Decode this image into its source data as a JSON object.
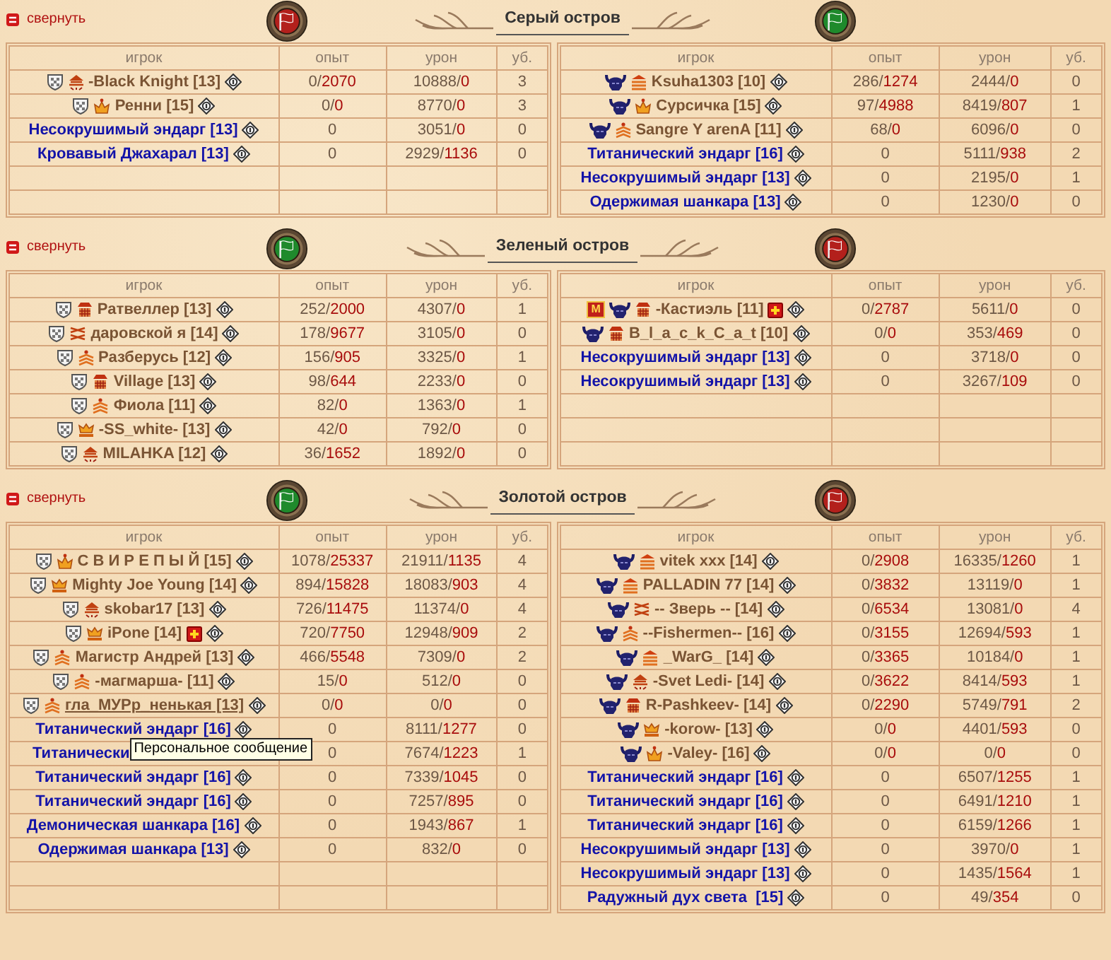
{
  "sections": [
    {
      "collapse_label": "свернуть",
      "title": "Серый остров",
      "flags": [
        {
          "color": "#b3201c"
        },
        {
          "color": "#1f8a2c"
        }
      ],
      "teams": [
        {
          "columns": [
            "игрок",
            "опыт",
            "урон",
            "уб."
          ],
          "rows": [
            {
              "kind": "player",
              "icons": [
                {
                  "kind": "shield"
                },
                {
                  "kind": "pyramid"
                }
              ],
              "name": "-Black Knight [13]",
              "after": [
                {
                  "kind": "info"
                }
              ],
              "hovered": false,
              "exp": "0/2070",
              "damage": "10888/0",
              "kills": "3"
            },
            {
              "kind": "player",
              "icons": [
                {
                  "kind": "shield"
                },
                {
                  "kind": "crown"
                }
              ],
              "name": "Ренни [15]",
              "after": [
                {
                  "kind": "info"
                }
              ],
              "hovered": false,
              "exp": "0/0",
              "damage": "8770/0",
              "kills": "3"
            },
            {
              "kind": "monster",
              "name": "Несокрушимый эндарг [13]",
              "after": [
                {
                  "kind": "info"
                }
              ],
              "hovered": false,
              "exp": "0",
              "damage": "3051/0",
              "kills": "0"
            },
            {
              "kind": "monster",
              "name": "Кровавый Джахарал [13]",
              "after": [
                {
                  "kind": "info"
                }
              ],
              "hovered": false,
              "exp": "0",
              "damage": "2929/1136",
              "kills": "0"
            }
          ]
        },
        {
          "columns": [
            "игрок",
            "опыт",
            "урон",
            "уб."
          ],
          "rows": [
            {
              "kind": "player",
              "icons": [
                {
                  "kind": "helmet"
                },
                {
                  "kind": "stripes"
                }
              ],
              "name": "Ksuha1303 [10]",
              "after": [
                {
                  "kind": "info"
                }
              ],
              "hovered": false,
              "exp": "286/1274",
              "damage": "2444/0",
              "kills": "0"
            },
            {
              "kind": "player",
              "icons": [
                {
                  "kind": "helmet"
                },
                {
                  "kind": "crown"
                }
              ],
              "name": "Сурсичка [15]",
              "after": [
                {
                  "kind": "info"
                }
              ],
              "hovered": false,
              "exp": "97/4988",
              "damage": "8419/807",
              "kills": "1"
            },
            {
              "kind": "player",
              "icons": [
                {
                  "kind": "helmet"
                },
                {
                  "kind": "chevron"
                }
              ],
              "name": "Sangre Y arenA [11]",
              "after": [
                {
                  "kind": "info"
                }
              ],
              "hovered": false,
              "exp": "68/0",
              "damage": "6096/0",
              "kills": "0"
            },
            {
              "kind": "monster",
              "name": "Титанический эндарг [16]",
              "after": [
                {
                  "kind": "info"
                }
              ],
              "hovered": false,
              "exp": "0",
              "damage": "5111/938",
              "kills": "2"
            },
            {
              "kind": "monster",
              "name": "Несокрушимый эндарг [13]",
              "after": [
                {
                  "kind": "info"
                }
              ],
              "hovered": false,
              "exp": "0",
              "damage": "2195/0",
              "kills": "1"
            },
            {
              "kind": "monster",
              "name": "Одержимая шанкара [13]",
              "after": [
                {
                  "kind": "info"
                }
              ],
              "hovered": false,
              "exp": "0",
              "damage": "1230/0",
              "kills": "0"
            }
          ]
        }
      ]
    },
    {
      "collapse_label": "свернуть",
      "title": "Зеленый остров",
      "flags": [
        {
          "color": "#1f8a2c"
        },
        {
          "color": "#b3201c"
        }
      ],
      "teams": [
        {
          "columns": [
            "игрок",
            "опыт",
            "урон",
            "уб."
          ],
          "rows": [
            {
              "kind": "player",
              "icons": [
                {
                  "kind": "shield"
                },
                {
                  "kind": "tower"
                }
              ],
              "name": "Ратвеллер [13]",
              "after": [
                {
                  "kind": "info"
                }
              ],
              "hovered": false,
              "exp": "252/2000",
              "damage": "4307/0",
              "kills": "1"
            },
            {
              "kind": "player",
              "icons": [
                {
                  "kind": "shield"
                },
                {
                  "kind": "cross"
                }
              ],
              "name": "даровской я [14]",
              "after": [
                {
                  "kind": "info"
                }
              ],
              "hovered": false,
              "exp": "178/9677",
              "damage": "3105/0",
              "kills": "0"
            },
            {
              "kind": "player",
              "icons": [
                {
                  "kind": "shield"
                },
                {
                  "kind": "chevron"
                }
              ],
              "name": "Разберусь [12]",
              "after": [
                {
                  "kind": "info"
                }
              ],
              "hovered": false,
              "exp": "156/905",
              "damage": "3325/0",
              "kills": "1"
            },
            {
              "kind": "player",
              "icons": [
                {
                  "kind": "shield"
                },
                {
                  "kind": "tower"
                }
              ],
              "name": "Village [13]",
              "after": [
                {
                  "kind": "info"
                }
              ],
              "hovered": false,
              "exp": "98/644",
              "damage": "2233/0",
              "kills": "0"
            },
            {
              "kind": "player",
              "icons": [
                {
                  "kind": "shield"
                },
                {
                  "kind": "chevron"
                }
              ],
              "name": "Фиола [11]",
              "after": [
                {
                  "kind": "info"
                }
              ],
              "hovered": false,
              "exp": "82/0",
              "damage": "1363/0",
              "kills": "1"
            },
            {
              "kind": "player",
              "icons": [
                {
                  "kind": "shield"
                },
                {
                  "kind": "crownbar"
                }
              ],
              "name": "-SS_white- [13]",
              "after": [
                {
                  "kind": "info"
                }
              ],
              "hovered": false,
              "exp": "42/0",
              "damage": "792/0",
              "kills": "0"
            },
            {
              "kind": "player",
              "icons": [
                {
                  "kind": "shield"
                },
                {
                  "kind": "pyramid"
                }
              ],
              "name": "MILAHKA [12]",
              "after": [
                {
                  "kind": "info"
                }
              ],
              "hovered": false,
              "exp": "36/1652",
              "damage": "1892/0",
              "kills": "0"
            }
          ]
        },
        {
          "columns": [
            "игрок",
            "опыт",
            "урон",
            "уб."
          ],
          "rows": [
            {
              "kind": "player",
              "tag": "M",
              "icons": [
                {
                  "kind": "helmet"
                },
                {
                  "kind": "tower"
                }
              ],
              "name": "-Кастиэль [11]",
              "after": [
                {
                  "kind": "injury"
                },
                {
                  "kind": "info"
                }
              ],
              "hovered": false,
              "exp": "0/2787",
              "damage": "5611/0",
              "kills": "0"
            },
            {
              "kind": "player",
              "icons": [
                {
                  "kind": "helmet"
                },
                {
                  "kind": "tower"
                }
              ],
              "name": "B_l_a_c_k_C_a_t [10]",
              "after": [
                {
                  "kind": "info"
                }
              ],
              "hovered": false,
              "exp": "0/0",
              "damage": "353/469",
              "kills": "0"
            },
            {
              "kind": "monster",
              "name": "Несокрушимый эндарг [13]",
              "after": [
                {
                  "kind": "info"
                }
              ],
              "hovered": false,
              "exp": "0",
              "damage": "3718/0",
              "kills": "0"
            },
            {
              "kind": "monster",
              "name": "Несокрушимый эндарг [13]",
              "after": [
                {
                  "kind": "info"
                }
              ],
              "hovered": false,
              "exp": "0",
              "damage": "3267/109",
              "kills": "0"
            }
          ]
        }
      ]
    },
    {
      "collapse_label": "свернуть",
      "title": "Золотой остров",
      "flags": [
        {
          "color": "#1f8a2c"
        },
        {
          "color": "#b3201c"
        }
      ],
      "teams": [
        {
          "columns": [
            "игрок",
            "опыт",
            "урон",
            "уб."
          ],
          "rows": [
            {
              "kind": "player",
              "icons": [
                {
                  "kind": "shield"
                },
                {
                  "kind": "crown"
                }
              ],
              "name": "С В И Р Е П Ы Й [15]",
              "after": [
                {
                  "kind": "info"
                }
              ],
              "hovered": false,
              "exp": "1078/25337",
              "damage": "21911/1135",
              "kills": "4"
            },
            {
              "kind": "player",
              "icons": [
                {
                  "kind": "shield"
                },
                {
                  "kind": "crownbar"
                }
              ],
              "name": "Mighty Joe Young [14]",
              "after": [
                {
                  "kind": "info"
                }
              ],
              "hovered": false,
              "exp": "894/15828",
              "damage": "18083/903",
              "kills": "4"
            },
            {
              "kind": "player",
              "icons": [
                {
                  "kind": "shield"
                },
                {
                  "kind": "pyramid"
                }
              ],
              "name": "skobar17 [13]",
              "after": [
                {
                  "kind": "info"
                }
              ],
              "hovered": false,
              "exp": "726/11475",
              "damage": "11374/0",
              "kills": "4"
            },
            {
              "kind": "player",
              "icons": [
                {
                  "kind": "shield"
                },
                {
                  "kind": "crownbar"
                }
              ],
              "name": "iPone [14]",
              "after": [
                {
                  "kind": "injury"
                },
                {
                  "kind": "info"
                }
              ],
              "hovered": false,
              "exp": "720/7750",
              "damage": "12948/909",
              "kills": "2"
            },
            {
              "kind": "player",
              "icons": [
                {
                  "kind": "shield"
                },
                {
                  "kind": "chevron"
                }
              ],
              "name": "Магистр Андрей [13]",
              "after": [
                {
                  "kind": "info"
                }
              ],
              "hovered": false,
              "exp": "466/5548",
              "damage": "7309/0",
              "kills": "2"
            },
            {
              "kind": "player",
              "icons": [
                {
                  "kind": "shield"
                },
                {
                  "kind": "chevron"
                }
              ],
              "name": "-магмарша- [11]",
              "after": [
                {
                  "kind": "info"
                }
              ],
              "hovered": false,
              "exp": "15/0",
              "damage": "512/0",
              "kills": "0"
            },
            {
              "kind": "player",
              "icons": [
                {
                  "kind": "shield"
                },
                {
                  "kind": "chevron"
                }
              ],
              "name": "гла_МУРр_ненькая [13]",
              "after": [
                {
                  "kind": "info"
                }
              ],
              "hovered": true,
              "exp": "0/0",
              "damage": "0/0",
              "kills": "0"
            },
            {
              "kind": "monster",
              "name": "Титанический эндарг [16]",
              "after": [
                {
                  "kind": "info"
                }
              ],
              "hovered": false,
              "exp": "0",
              "damage": "8111/1277",
              "kills": "0"
            },
            {
              "kind": "monster",
              "name": "Титанически",
              "tooltip": "Персональное сообщение",
              "hovered": false,
              "exp": "0",
              "damage": "7674/1223",
              "kills": "1"
            },
            {
              "kind": "monster",
              "name": "Титанический эндарг [16]",
              "after": [
                {
                  "kind": "info"
                }
              ],
              "hovered": false,
              "exp": "0",
              "damage": "7339/1045",
              "kills": "0"
            },
            {
              "kind": "monster",
              "name": "Титанический эндарг [16]",
              "after": [
                {
                  "kind": "info"
                }
              ],
              "hovered": false,
              "exp": "0",
              "damage": "7257/895",
              "kills": "0"
            },
            {
              "kind": "monster",
              "name": "Демоническая шанкара [16]",
              "after": [
                {
                  "kind": "info"
                }
              ],
              "hovered": false,
              "exp": "0",
              "damage": "1943/867",
              "kills": "1"
            },
            {
              "kind": "monster",
              "name": "Одержимая шанкара [13]",
              "after": [
                {
                  "kind": "info"
                }
              ],
              "hovered": false,
              "exp": "0",
              "damage": "832/0",
              "kills": "0"
            }
          ]
        },
        {
          "columns": [
            "игрок",
            "опыт",
            "урон",
            "уб."
          ],
          "rows": [
            {
              "kind": "player",
              "icons": [
                {
                  "kind": "helmet"
                },
                {
                  "kind": "stripes"
                }
              ],
              "name": "vitek xxx [14]",
              "after": [
                {
                  "kind": "info"
                }
              ],
              "hovered": false,
              "exp": "0/2908",
              "damage": "16335/1260",
              "kills": "1"
            },
            {
              "kind": "player",
              "icons": [
                {
                  "kind": "helmet"
                },
                {
                  "kind": "stripes"
                }
              ],
              "name": "PALLADIN 77 [14]",
              "after": [
                {
                  "kind": "info"
                }
              ],
              "hovered": false,
              "exp": "0/3832",
              "damage": "13119/0",
              "kills": "1"
            },
            {
              "kind": "player",
              "icons": [
                {
                  "kind": "helmet"
                },
                {
                  "kind": "cross"
                }
              ],
              "name": "-- Зверь -- [14]",
              "after": [
                {
                  "kind": "info"
                }
              ],
              "hovered": false,
              "exp": "0/6534",
              "damage": "13081/0",
              "kills": "4"
            },
            {
              "kind": "player",
              "icons": [
                {
                  "kind": "helmet"
                },
                {
                  "kind": "chevron"
                }
              ],
              "name": "--Fishermen-- [16]",
              "after": [
                {
                  "kind": "info"
                }
              ],
              "hovered": false,
              "exp": "0/3155",
              "damage": "12694/593",
              "kills": "1"
            },
            {
              "kind": "player",
              "icons": [
                {
                  "kind": "helmet"
                },
                {
                  "kind": "stripes"
                }
              ],
              "name": "_WarG_ [14]",
              "after": [
                {
                  "kind": "info"
                }
              ],
              "hovered": false,
              "exp": "0/3365",
              "damage": "10184/0",
              "kills": "1"
            },
            {
              "kind": "player",
              "icons": [
                {
                  "kind": "helmet"
                },
                {
                  "kind": "pyramid"
                }
              ],
              "name": "-Svet Ledi- [14]",
              "after": [
                {
                  "kind": "info"
                }
              ],
              "hovered": false,
              "exp": "0/3622",
              "damage": "8414/593",
              "kills": "1"
            },
            {
              "kind": "player",
              "icons": [
                {
                  "kind": "helmet"
                },
                {
                  "kind": "tower"
                }
              ],
              "name": "R-Pashkeev- [14]",
              "after": [
                {
                  "kind": "info"
                }
              ],
              "hovered": false,
              "exp": "0/2290",
              "damage": "5749/791",
              "kills": "2"
            },
            {
              "kind": "player",
              "icons": [
                {
                  "kind": "helmet"
                },
                {
                  "kind": "crownbar"
                }
              ],
              "name": "-korow- [13]",
              "after": [
                {
                  "kind": "info"
                }
              ],
              "hovered": false,
              "exp": "0/0",
              "damage": "4401/593",
              "kills": "0"
            },
            {
              "kind": "player",
              "icons": [
                {
                  "kind": "helmet"
                },
                {
                  "kind": "crown"
                }
              ],
              "name": "-Valey- [16]",
              "after": [
                {
                  "kind": "info"
                }
              ],
              "hovered": false,
              "exp": "0/0",
              "damage": "0/0",
              "kills": "0"
            },
            {
              "kind": "monster",
              "name": "Титанический эндарг [16]",
              "after": [
                {
                  "kind": "info"
                }
              ],
              "hovered": false,
              "exp": "0",
              "damage": "6507/1255",
              "kills": "1"
            },
            {
              "kind": "monster",
              "name": "Титанический эндарг [16]",
              "after": [
                {
                  "kind": "info"
                }
              ],
              "hovered": false,
              "exp": "0",
              "damage": "6491/1210",
              "kills": "1"
            },
            {
              "kind": "monster",
              "name": "Титанический эндарг [16]",
              "after": [
                {
                  "kind": "info"
                }
              ],
              "hovered": false,
              "exp": "0",
              "damage": "6159/1266",
              "kills": "1"
            },
            {
              "kind": "monster",
              "name": "Несокрушимый эндарг [13]",
              "after": [
                {
                  "kind": "info"
                }
              ],
              "hovered": false,
              "exp": "0",
              "damage": "3970/0",
              "kills": "1"
            },
            {
              "kind": "monster",
              "name": "Несокрушимый эндарг [13]",
              "after": [
                {
                  "kind": "info"
                }
              ],
              "hovered": false,
              "exp": "0",
              "damage": "1435/1564",
              "kills": "1"
            },
            {
              "kind": "monster",
              "name": "Радужный дух света  [15]",
              "after": [
                {
                  "kind": "info"
                }
              ],
              "hovered": false,
              "exp": "0",
              "damage": "49/354",
              "kills": "0"
            }
          ]
        }
      ]
    }
  ]
}
